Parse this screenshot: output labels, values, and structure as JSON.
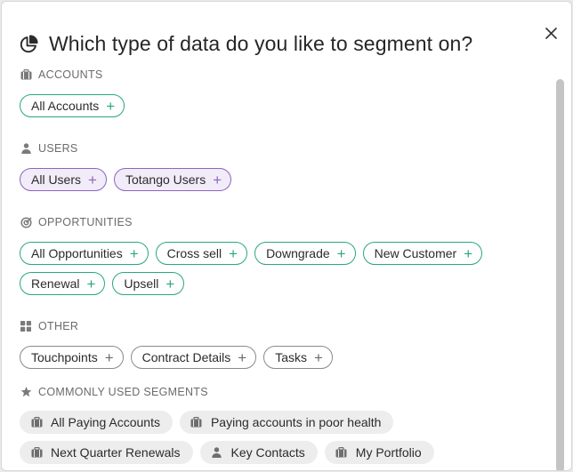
{
  "dialog": {
    "title": "Which type of data do you like to segment on?",
    "title_icon": "pie-chart-icon",
    "close_icon": "close-icon"
  },
  "sections": {
    "accounts": {
      "label": "ACCOUNTS",
      "icon": "briefcase-icon",
      "chips": [
        "All Accounts"
      ]
    },
    "users": {
      "label": "USERS",
      "icon": "person-icon",
      "chips": [
        "All Users",
        "Totango Users"
      ]
    },
    "opportunities": {
      "label": "OPPORTUNITIES",
      "icon": "target-icon",
      "chips": [
        "All Opportunities",
        "Cross sell",
        "Downgrade",
        "New Customer",
        "Renewal",
        "Upsell"
      ]
    },
    "other": {
      "label": "OTHER",
      "icon": "grid-icon",
      "chips": [
        "Touchpoints",
        "Contract Details",
        "Tasks"
      ]
    },
    "common": {
      "label": "COMMONLY USED SEGMENTS",
      "icon": "star-icon",
      "segments": [
        {
          "label": "All Paying Accounts",
          "icon": "briefcase-icon"
        },
        {
          "label": "Paying accounts in poor health",
          "icon": "briefcase-icon"
        },
        {
          "label": "Next Quarter Renewals",
          "icon": "briefcase-icon"
        },
        {
          "label": "Key Contacts",
          "icon": "person-icon"
        },
        {
          "label": "My Portfolio",
          "icon": "briefcase-icon"
        }
      ]
    }
  },
  "plus_glyph": "+",
  "colors": {
    "accounts_accent": "#2aa87a",
    "users_accent": "#8b64c2",
    "users_fill": "#f1ecf8",
    "other_border": "#8a8a8a",
    "segment_fill": "#ededed"
  }
}
